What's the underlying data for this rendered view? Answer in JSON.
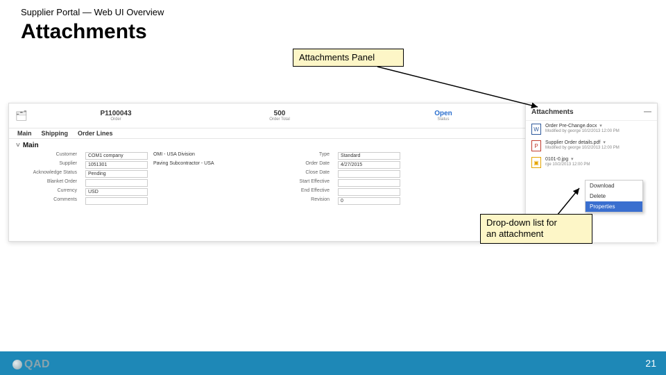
{
  "header": {
    "crumb": "Supplier Portal — Web UI Overview",
    "title": "Attachments"
  },
  "callouts": {
    "panel": "Attachments Panel",
    "dropdown_line1": "Drop-down list for",
    "dropdown_line2": "an attachment"
  },
  "orderbar": {
    "order": {
      "label": "Order",
      "value": "P1100043"
    },
    "total": {
      "label": "Order Total",
      "value": "500"
    },
    "status": {
      "label": "Status",
      "value": "Open"
    }
  },
  "tabs": [
    "Main",
    "Shipping",
    "Order Lines"
  ],
  "section": "Main",
  "fields": {
    "left": [
      {
        "label": "Customer",
        "box": "COM1 company",
        "plain": "OMI - USA Division"
      },
      {
        "label": "Supplier",
        "box": "1051301",
        "plain": "Paving Subcontractor - USA"
      },
      {
        "label": "Acknowledge Status",
        "box": "Pending",
        "plain": ""
      },
      {
        "label": "Blanket Order",
        "box": "",
        "plain": ""
      },
      {
        "label": "Currency",
        "box": "USD",
        "plain": ""
      },
      {
        "label": "Comments",
        "box": "",
        "plain": ""
      }
    ],
    "right": [
      {
        "label": "Type",
        "box": "Standard"
      },
      {
        "label": "Order Date",
        "box": "4/27/2015"
      },
      {
        "label": "Close Date",
        "box": ""
      },
      {
        "label": "Start Effective",
        "box": ""
      },
      {
        "label": "End Effective",
        "box": ""
      },
      {
        "label": "Revision",
        "box": "0"
      }
    ]
  },
  "attachments": {
    "panel_title": "Attachments",
    "items": [
      {
        "icon": "W",
        "name": "Order Pre-Change.docx",
        "meta": "Modified by george 10/2/2013 12:00 PM"
      },
      {
        "icon": "P",
        "name": "Supplier Order details.pdf",
        "meta": "Modified by george 10/2/2013 12:00 PM"
      },
      {
        "icon": "▣",
        "name": "0101-0.jpg",
        "meta": "rge 10/2/2013 12:00 PM"
      }
    ],
    "menu": {
      "download": "Download",
      "delete": "Delete",
      "properties": "Properties"
    }
  },
  "footer": {
    "page": "21",
    "logo": "QAD"
  }
}
